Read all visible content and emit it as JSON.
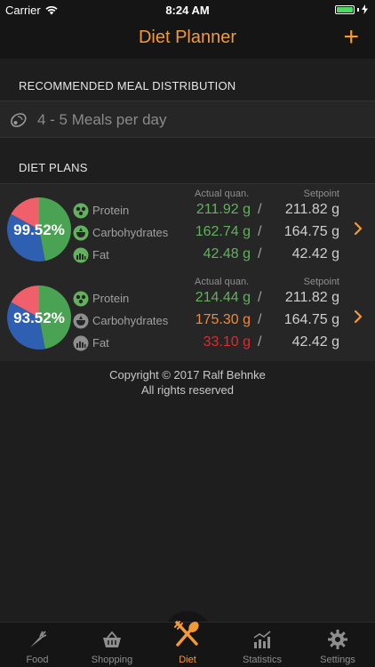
{
  "status": {
    "carrier": "Carrier",
    "time": "8:24 AM"
  },
  "nav": {
    "title": "Diet Planner",
    "add": "+"
  },
  "sections": {
    "meal_distribution": "RECOMMENDED MEAL DISTRIBUTION",
    "diet_plans": "DIET PLANS"
  },
  "meals": {
    "text": "4 - 5 Meals per day",
    "icon": "meat-icon"
  },
  "columns": {
    "actual": "Actual quan.",
    "setpoint": "Setpoint"
  },
  "plans": [
    {
      "percent": "99.52%",
      "pie_shares": {
        "protein": 0.47,
        "carbohydrates": 0.36,
        "fat": 0.17
      },
      "macros": [
        {
          "name": "Protein",
          "actual": "211.92 g",
          "setpoint": "211.82 g",
          "status": "green"
        },
        {
          "name": "Carbohydrates",
          "actual": "162.74 g",
          "setpoint": "164.75 g",
          "status": "green"
        },
        {
          "name": "Fat",
          "actual": "42.48 g",
          "setpoint": "42.42 g",
          "status": "green"
        }
      ]
    },
    {
      "percent": "93.52%",
      "pie_shares": {
        "protein": 0.47,
        "carbohydrates": 0.36,
        "fat": 0.17
      },
      "macros": [
        {
          "name": "Protein",
          "actual": "214.44 g",
          "setpoint": "211.82 g",
          "status": "green"
        },
        {
          "name": "Carbohydrates",
          "actual": "175.30 g",
          "setpoint": "164.75 g",
          "status": "orange"
        },
        {
          "name": "Fat",
          "actual": "33.10 g",
          "setpoint": "42.42 g",
          "status": "red"
        }
      ]
    }
  ],
  "separator": "/",
  "copyright": {
    "line1": "Copyright © 2017 Ralf Behnke",
    "line2": "All rights reserved"
  },
  "tabs": [
    {
      "label": "Food",
      "icon": "carrot-icon"
    },
    {
      "label": "Shopping",
      "icon": "basket-icon"
    },
    {
      "label": "Diet",
      "icon": "fork-spoon-icon",
      "active": true
    },
    {
      "label": "Statistics",
      "icon": "bar-chart-icon"
    },
    {
      "label": "Settings",
      "icon": "gear-icon"
    }
  ],
  "colors": {
    "accent": "#f39a38",
    "good": "#63b05f",
    "warn": "#f0893a",
    "bad": "#e02b2b",
    "protein": "#4aa253",
    "carbs": "#2f5fb0",
    "fat": "#f0606a"
  }
}
